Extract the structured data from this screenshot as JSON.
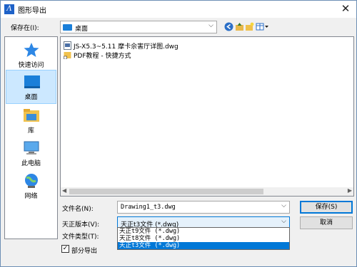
{
  "window": {
    "title": "图形导出",
    "close_glyph": "✕"
  },
  "location": {
    "label": "保存在(I):",
    "value": "桌面"
  },
  "places": [
    {
      "label": "快速访问"
    },
    {
      "label": "桌面"
    },
    {
      "label": "库"
    },
    {
      "label": "此电脑"
    },
    {
      "label": "网络"
    }
  ],
  "files": [
    {
      "name": "JS-X5.3~5.11 摩卡佘害厅详图.dwg"
    },
    {
      "name": "PDF教程 - 快捷方式"
    }
  ],
  "form": {
    "filename_label": "文件名(N):",
    "filename_value": "Drawing1_t3.dwg",
    "version_label": "天正版本(V):",
    "version_value": "天正t3文件 (*.dwg)",
    "filetype_label": "文件类型(T):",
    "partial_export_label": "部分导出",
    "partial_export_checked": true
  },
  "version_options": [
    "天正t9文件 (*.dwg)",
    "天正t8文件 (*.dwg)",
    "天正t3文件 (*.dwg)"
  ],
  "buttons": {
    "save": "保存(S)",
    "cancel": "取消"
  },
  "colors": {
    "accent": "#0078d7",
    "folder_blue": "#1a7fd9",
    "selection_bg": "#cce8ff"
  }
}
